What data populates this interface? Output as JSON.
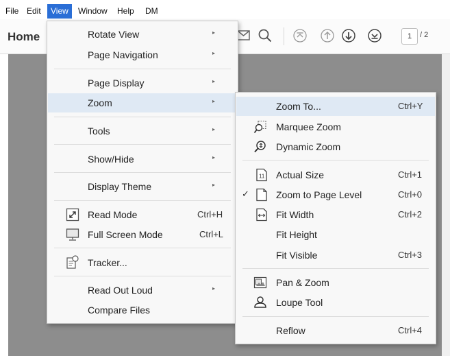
{
  "menubar": {
    "items": [
      {
        "label": "File",
        "active": false
      },
      {
        "label": "Edit",
        "active": false
      },
      {
        "label": "View",
        "active": true
      },
      {
        "label": "Window",
        "active": false
      },
      {
        "label": "Help",
        "active": false
      },
      {
        "label": "DM",
        "active": false
      }
    ]
  },
  "toolbar": {
    "home_label": "Home",
    "current_page": "1",
    "page_total": "/ 2"
  },
  "view_menu": {
    "items": [
      {
        "label": "Rotate View",
        "submenu": true,
        "shortcut": ""
      },
      {
        "label": "Page Navigation",
        "submenu": true,
        "shortcut": ""
      },
      {
        "label": "Page Display",
        "submenu": true,
        "shortcut": ""
      },
      {
        "label": "Zoom",
        "submenu": true,
        "shortcut": ""
      },
      {
        "label": "Tools",
        "submenu": true,
        "shortcut": ""
      },
      {
        "label": "Show/Hide",
        "submenu": true,
        "shortcut": ""
      },
      {
        "label": "Display Theme",
        "submenu": true,
        "shortcut": ""
      },
      {
        "label": "Read Mode",
        "submenu": false,
        "shortcut": "Ctrl+H",
        "icon": "read-mode-icon"
      },
      {
        "label": "Full Screen Mode",
        "submenu": false,
        "shortcut": "Ctrl+L",
        "icon": "full-screen-icon"
      },
      {
        "label": "Tracker...",
        "submenu": false,
        "shortcut": "",
        "icon": "tracker-icon"
      },
      {
        "label": "Read Out Loud",
        "submenu": true,
        "shortcut": ""
      },
      {
        "label": "Compare Files",
        "submenu": false,
        "shortcut": ""
      }
    ],
    "highlighted": "Zoom"
  },
  "zoom_menu": {
    "items": [
      {
        "label": "Zoom To...",
        "shortcut": "Ctrl+Y"
      },
      {
        "label": "Marquee Zoom",
        "shortcut": "",
        "icon": "marquee-zoom-icon"
      },
      {
        "label": "Dynamic Zoom",
        "shortcut": "",
        "icon": "dynamic-zoom-icon"
      },
      {
        "label": "Actual Size",
        "shortcut": "Ctrl+1",
        "icon": "actual-size-icon"
      },
      {
        "label": "Zoom to Page Level",
        "shortcut": "Ctrl+0",
        "icon": "page-level-icon",
        "checked": true
      },
      {
        "label": "Fit Width",
        "shortcut": "Ctrl+2",
        "icon": "fit-width-icon"
      },
      {
        "label": "Fit Height",
        "shortcut": ""
      },
      {
        "label": "Fit Visible",
        "shortcut": "Ctrl+3"
      },
      {
        "label": "Pan & Zoom",
        "shortcut": "",
        "icon": "pan-zoom-icon"
      },
      {
        "label": "Loupe Tool",
        "shortcut": "",
        "icon": "loupe-tool-icon"
      },
      {
        "label": "Reflow",
        "shortcut": "Ctrl+4"
      }
    ],
    "highlighted": "Zoom To...",
    "check_mark": "✓"
  },
  "glyphs": {
    "submenu_arrow": "▸"
  },
  "colors": {
    "menubar_active": "#2a6ed6",
    "menu_highlight": "#dfe9f4",
    "canvas": "#8d8d8d"
  }
}
